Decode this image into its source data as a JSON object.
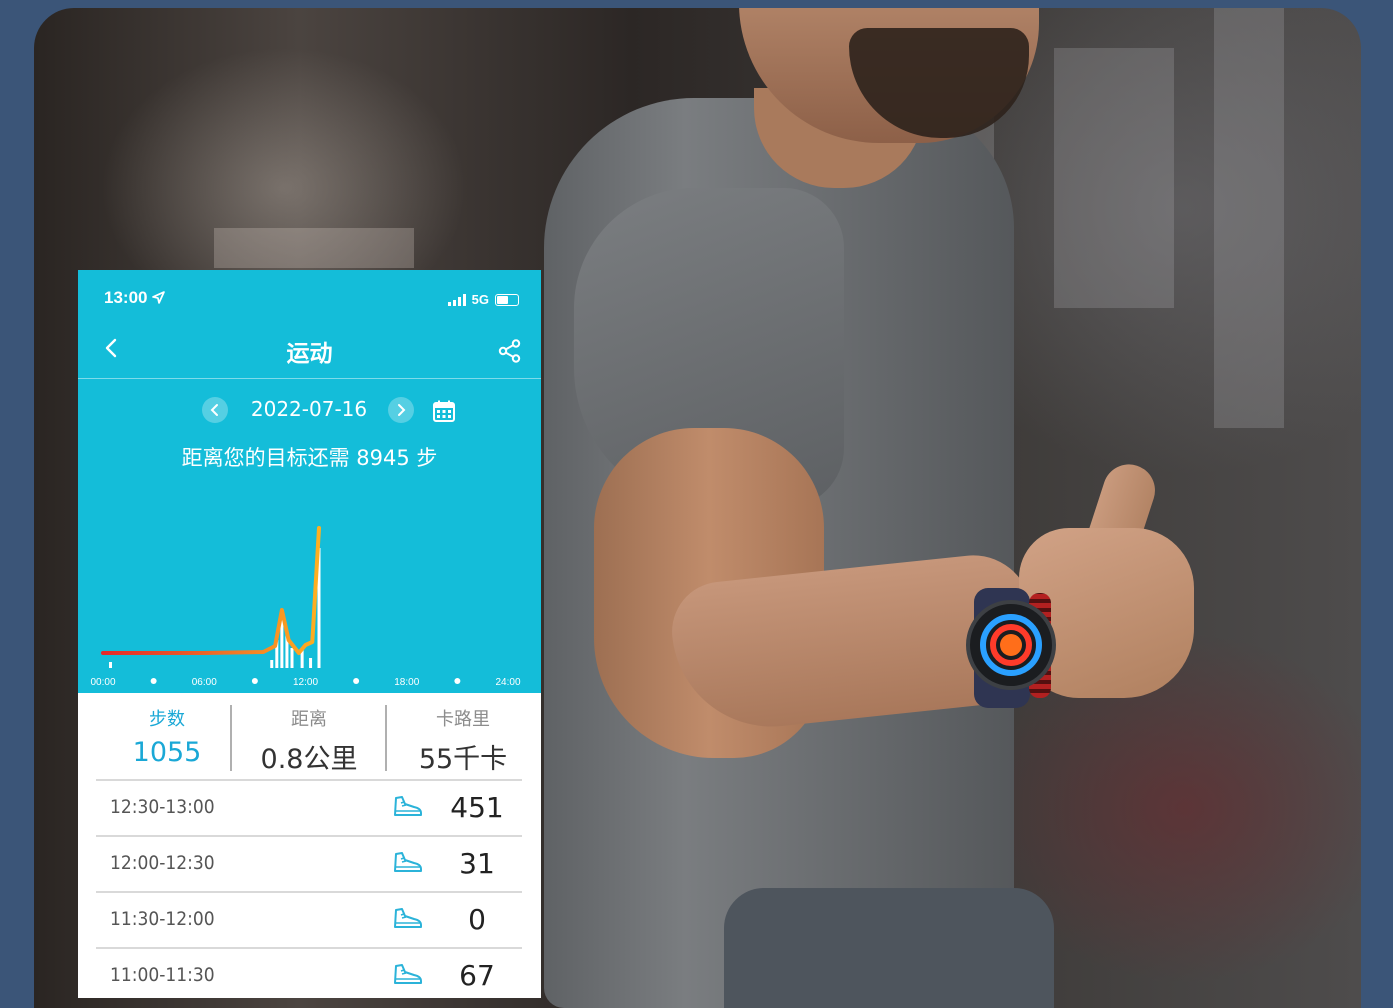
{
  "status_bar": {
    "time": "13:00",
    "network": "5G"
  },
  "nav": {
    "title": "运动"
  },
  "date_selector": {
    "date": "2022-07-16"
  },
  "goal_message": "距离您的目标还需 8945 步",
  "chart_data": {
    "type": "line",
    "x_tick_labels": [
      "00:00",
      "06:00",
      "12:00",
      "18:00",
      "24:00"
    ],
    "line_points": [
      {
        "t": 0.0,
        "v": 15
      },
      {
        "t": 6.0,
        "v": 15
      },
      {
        "t": 9.5,
        "v": 16
      },
      {
        "t": 10.2,
        "v": 22
      },
      {
        "t": 10.6,
        "v": 58
      },
      {
        "t": 11.0,
        "v": 28
      },
      {
        "t": 11.6,
        "v": 15
      },
      {
        "t": 12.0,
        "v": 23
      },
      {
        "t": 12.4,
        "v": 26
      },
      {
        "t": 12.8,
        "v": 140
      }
    ],
    "bars": [
      {
        "t": 10.0,
        "v": 8
      },
      {
        "t": 10.3,
        "v": 28
      },
      {
        "t": 10.6,
        "v": 55
      },
      {
        "t": 10.9,
        "v": 35
      },
      {
        "t": 11.2,
        "v": 20
      },
      {
        "t": 11.8,
        "v": 18
      },
      {
        "t": 12.3,
        "v": 10
      },
      {
        "t": 12.8,
        "v": 120
      }
    ],
    "x_range": [
      0,
      24
    ],
    "colors": {
      "line_start": "#e52a2a",
      "line_end": "#ffb020",
      "bars": "#ffffff"
    }
  },
  "stats": [
    {
      "label": "步数",
      "value": "1055"
    },
    {
      "label": "距离",
      "value": "0.8公里"
    },
    {
      "label": "卡路里",
      "value": "55千卡"
    }
  ],
  "records": [
    {
      "time": "12:30-13:00",
      "value": "451"
    },
    {
      "time": "12:00-12:30",
      "value": "31"
    },
    {
      "time": "11:30-12:00",
      "value": "0"
    },
    {
      "time": "11:00-11:30",
      "value": "67"
    }
  ],
  "icons": {
    "back": "chevron-left-icon",
    "share": "share-icon",
    "prev": "chevron-left-icon",
    "next": "chevron-right-icon",
    "calendar": "calendar-icon",
    "shoe": "shoe-icon"
  },
  "colors": {
    "accent": "#14bdd9",
    "active_text": "#1aa8d6"
  }
}
